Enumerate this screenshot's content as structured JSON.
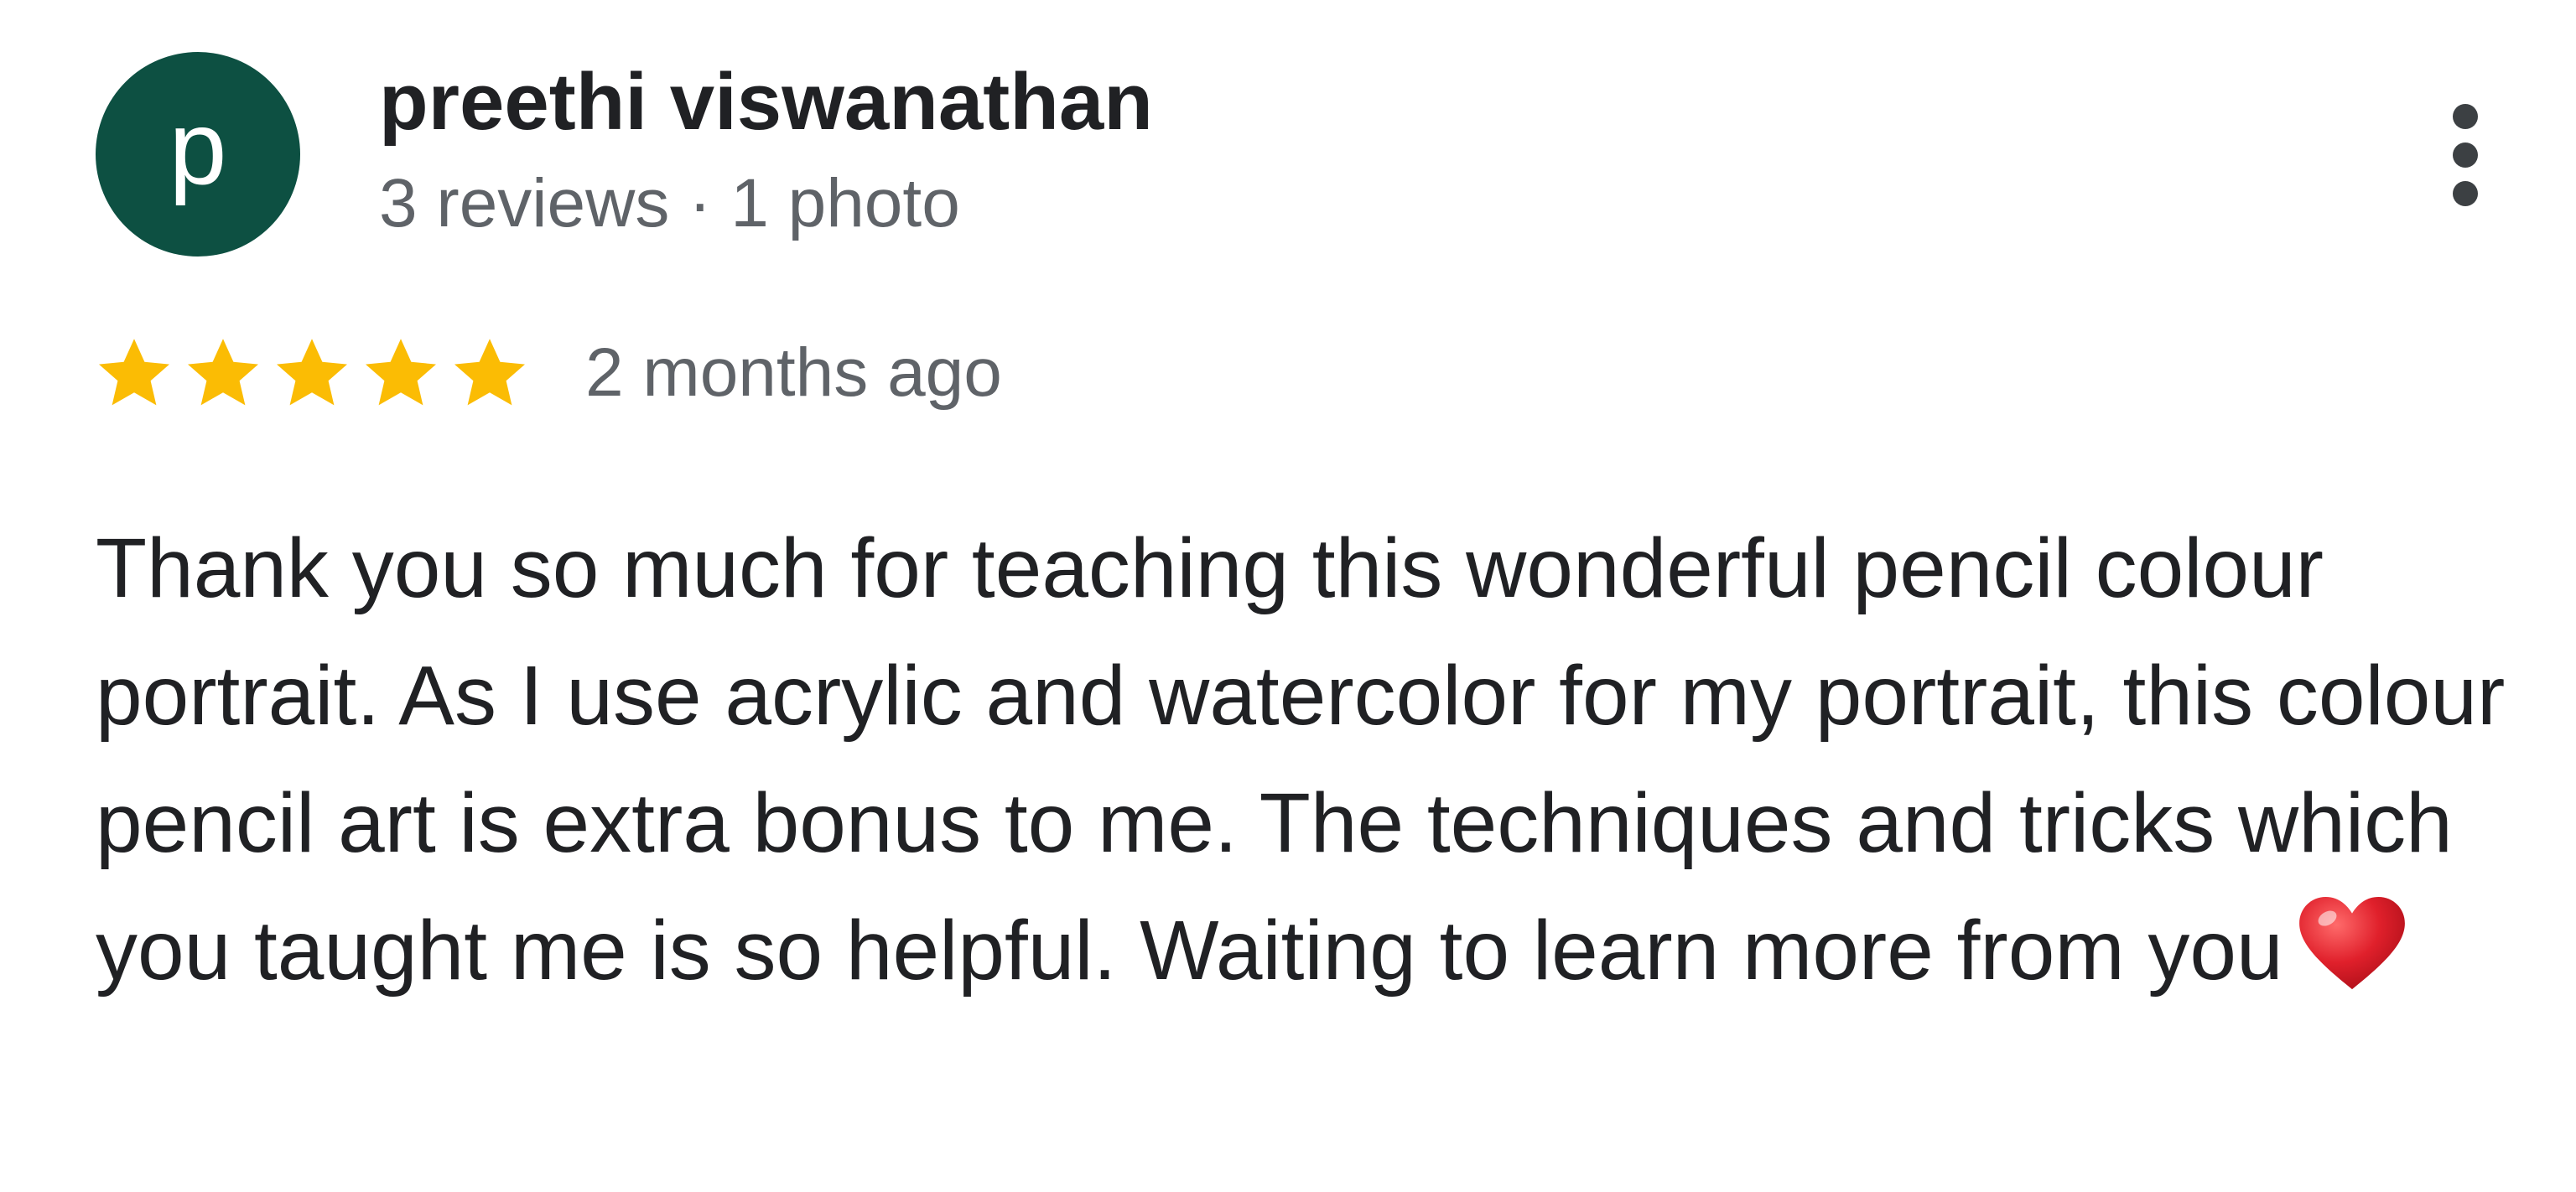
{
  "reviewer": {
    "avatar_letter": "p",
    "name": "preethi viswanathan",
    "meta": "3 reviews · 1 photo"
  },
  "rating": {
    "stars": 5,
    "max_stars": 5,
    "date": "2 months ago"
  },
  "review": {
    "text": "Thank you so much for teaching this wonderful pencil colour portrait. As I use acrylic and watercolor for my portrait, this colour pencil art is extra bonus to me. The techniques and tricks which you taught me is so helpful. Waiting to learn more from you",
    "trailing_icon": "red-heart-emoji"
  },
  "colors": {
    "avatar_bg": "#0d5042",
    "star": "#fbbc04",
    "secondary_text": "#5f6368",
    "primary_text": "#202124",
    "heart": "#e0202b"
  },
  "icons": {
    "menu": "more-vert-icon",
    "rating": "star-icon"
  }
}
